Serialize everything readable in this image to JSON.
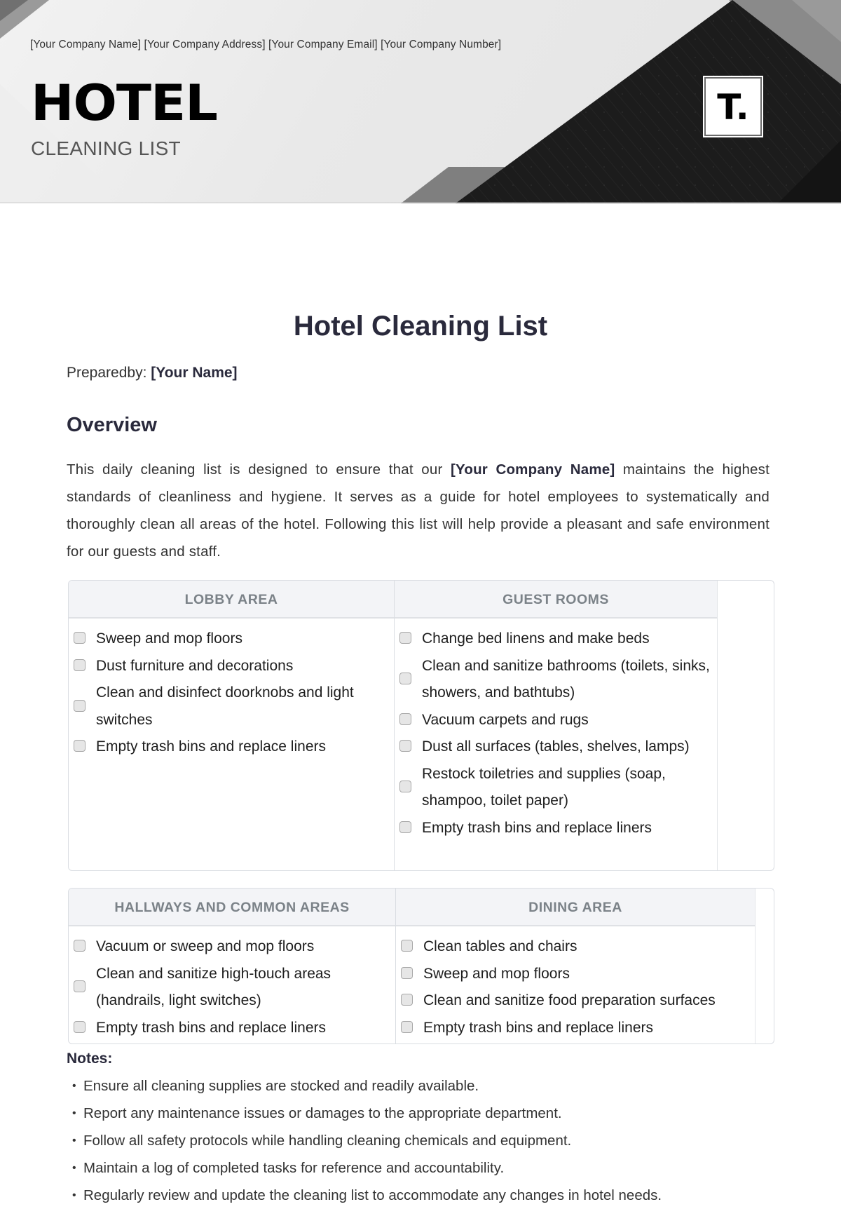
{
  "header": {
    "company_line": "[Your Company Name] [Your Company Address] [Your Company Email] [Your Company Number]",
    "brand_title": "HOTEL",
    "brand_subtitle": "CLEANING LIST",
    "logo_text": "T."
  },
  "document": {
    "title": "Hotel Cleaning List",
    "prepared_by_label": "Preparedby:",
    "prepared_by_value": "[Your Name]",
    "overview_heading": "Overview",
    "overview_text_before": "This daily cleaning list is designed to ensure that our ",
    "overview_company": "[Your Company Name]",
    "overview_text_after": " maintains the highest standards of cleanliness and hygiene. It serves as a guide for hotel employees to systematically and thoroughly clean all areas of the hotel. Following this list will help provide a pleasant and safe environment for our guests and staff."
  },
  "tables": [
    {
      "columns": [
        {
          "heading": "LOBBY AREA",
          "items": [
            {
              "text": "Sweep and mop floors",
              "checked": false
            },
            {
              "text": "Dust furniture and decorations",
              "checked": false
            },
            {
              "text": "Clean and disinfect doorknobs and light switches",
              "checked": false
            },
            {
              "text": "Empty trash bins and replace liners",
              "checked": false
            }
          ]
        },
        {
          "heading": "GUEST ROOMS",
          "items": [
            {
              "text": "Change bed linens and make beds",
              "checked": false
            },
            {
              "text": "Clean and sanitize bathrooms (toilets, sinks, showers, and bathtubs)",
              "checked": false
            },
            {
              "text": "Vacuum carpets and rugs",
              "checked": false
            },
            {
              "text": "Dust all surfaces (tables, shelves, lamps)",
              "checked": false
            },
            {
              "text": "Restock toiletries and supplies (soap, shampoo, toilet paper)",
              "checked": false
            },
            {
              "text": "Empty trash bins and replace liners",
              "checked": false
            }
          ]
        }
      ]
    },
    {
      "columns": [
        {
          "heading": "HALLWAYS AND COMMON AREAS",
          "items": [
            {
              "text": "Vacuum or sweep and mop floors",
              "checked": false
            },
            {
              "text": "Clean and sanitize high-touch areas (handrails, light switches)",
              "checked": false
            },
            {
              "text": "Empty trash bins and replace liners",
              "checked": false
            }
          ]
        },
        {
          "heading": "DINING AREA",
          "items": [
            {
              "text": "Clean tables and chairs",
              "checked": false
            },
            {
              "text": "Sweep and mop floors",
              "checked": false
            },
            {
              "text": "Clean and sanitize food preparation surfaces",
              "checked": false
            },
            {
              "text": "Empty trash bins and replace liners",
              "checked": false
            }
          ]
        }
      ]
    }
  ],
  "notes": {
    "heading": "Notes:",
    "items": [
      "Ensure all cleaning supplies are stocked and readily available.",
      "Report any maintenance issues or damages to the appropriate department.",
      "Follow all safety protocols while handling cleaning chemicals and equipment.",
      "Maintain a log of completed tasks for reference and accountability.",
      "Regularly review and update the cleaning list to accommodate any changes in hotel needs."
    ]
  },
  "colors": {
    "text_dark": "#2a2a3c",
    "table_header_bg": "#f3f4f7",
    "table_header_text": "#7b8288",
    "table_border": "#dadde2",
    "banner_dark": "#1c1c1c"
  }
}
